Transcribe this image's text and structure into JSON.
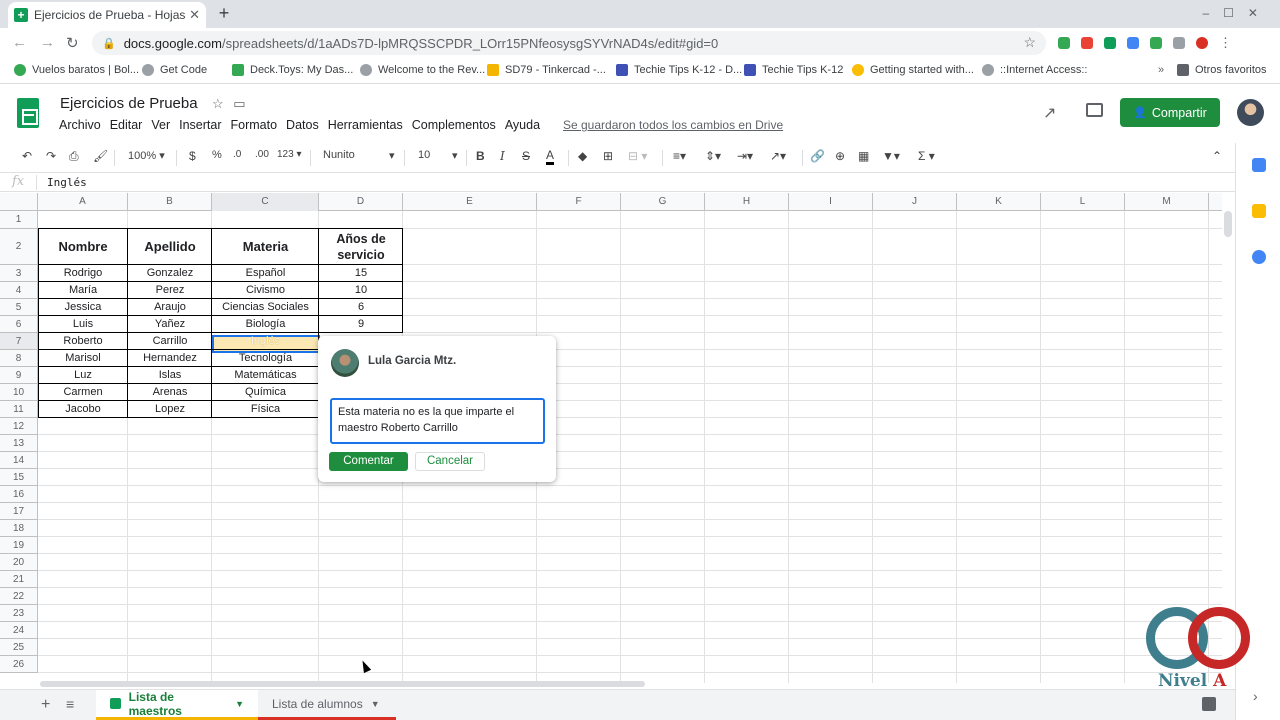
{
  "browser": {
    "tab_title": "Ejercicios de Prueba - Hojas de",
    "url_host": "docs.google.com",
    "url_path": "/spreadsheets/d/1aADs7D-lpMRQSSCPDR_LOrr15PNfeosysgSYVrNAD4s/edit#gid=0"
  },
  "bookmarks": [
    "Vuelos baratos | Bol...",
    "Get Code",
    "Deck.Toys: My Das...",
    "Welcome to the Rev...",
    "SD79 - Tinkercad -...",
    "Techie Tips K-12 - D...",
    "Techie Tips K-12",
    "Getting started with...",
    "::Internet Access::",
    "Otros favoritos"
  ],
  "doc": {
    "title": "Ejercicios de Prueba",
    "menu": [
      "Archivo",
      "Editar",
      "Ver",
      "Insertar",
      "Formato",
      "Datos",
      "Herramientas",
      "Complementos",
      "Ayuda"
    ],
    "save_status": "Se guardaron todos los cambios en Drive",
    "share_label": "Compartir"
  },
  "toolbar": {
    "zoom": "100%",
    "currency": "$",
    "percent": "%",
    "dec_less": ".0",
    "dec_more": ".00",
    "format_more": "123",
    "font": "Nunito",
    "font_size": "10"
  },
  "formula_bar": {
    "fx": "fx",
    "value": "Inglés"
  },
  "columns": [
    "A",
    "B",
    "C",
    "D",
    "E",
    "F",
    "G",
    "H",
    "I",
    "J",
    "K",
    "L",
    "M"
  ],
  "rows": [
    "1",
    "2",
    "3",
    "4",
    "5",
    "6",
    "7",
    "8",
    "9",
    "10",
    "11",
    "12",
    "13",
    "14",
    "15",
    "16",
    "17",
    "18",
    "19",
    "20",
    "21",
    "22",
    "23",
    "24",
    "25",
    "26"
  ],
  "table": {
    "headers": [
      "Nombre",
      "Apellido",
      "Materia",
      "Años de servicio"
    ],
    "rows": [
      [
        "Rodrigo",
        "Gonzalez",
        "Español",
        "15"
      ],
      [
        "María",
        "Perez",
        "Civismo",
        "10"
      ],
      [
        "Jessica",
        "Araujo",
        "Ciencias Sociales",
        "6"
      ],
      [
        "Luis",
        "Yañez",
        "Biología",
        "9"
      ],
      [
        "Roberto",
        "Carrillo",
        "Inglés",
        ""
      ],
      [
        "Marisol",
        "Hernandez",
        "Tecnología",
        ""
      ],
      [
        "Luz",
        "Islas",
        "Matemáticas",
        ""
      ],
      [
        "Carmen",
        "Arenas",
        "Química",
        ""
      ],
      [
        "Jacobo",
        "Lopez",
        "Física",
        ""
      ]
    ]
  },
  "comment": {
    "author": "Lula Garcia Mtz.",
    "text": "Esta materia no es la que imparte el maestro Roberto Carrillo",
    "submit_label": "Comentar",
    "cancel_label": "Cancelar"
  },
  "sheets": [
    "Lista de maestros",
    "Lista de alumnos"
  ],
  "watermark": {
    "text_main": "Nivel",
    "text_accent": "A"
  }
}
